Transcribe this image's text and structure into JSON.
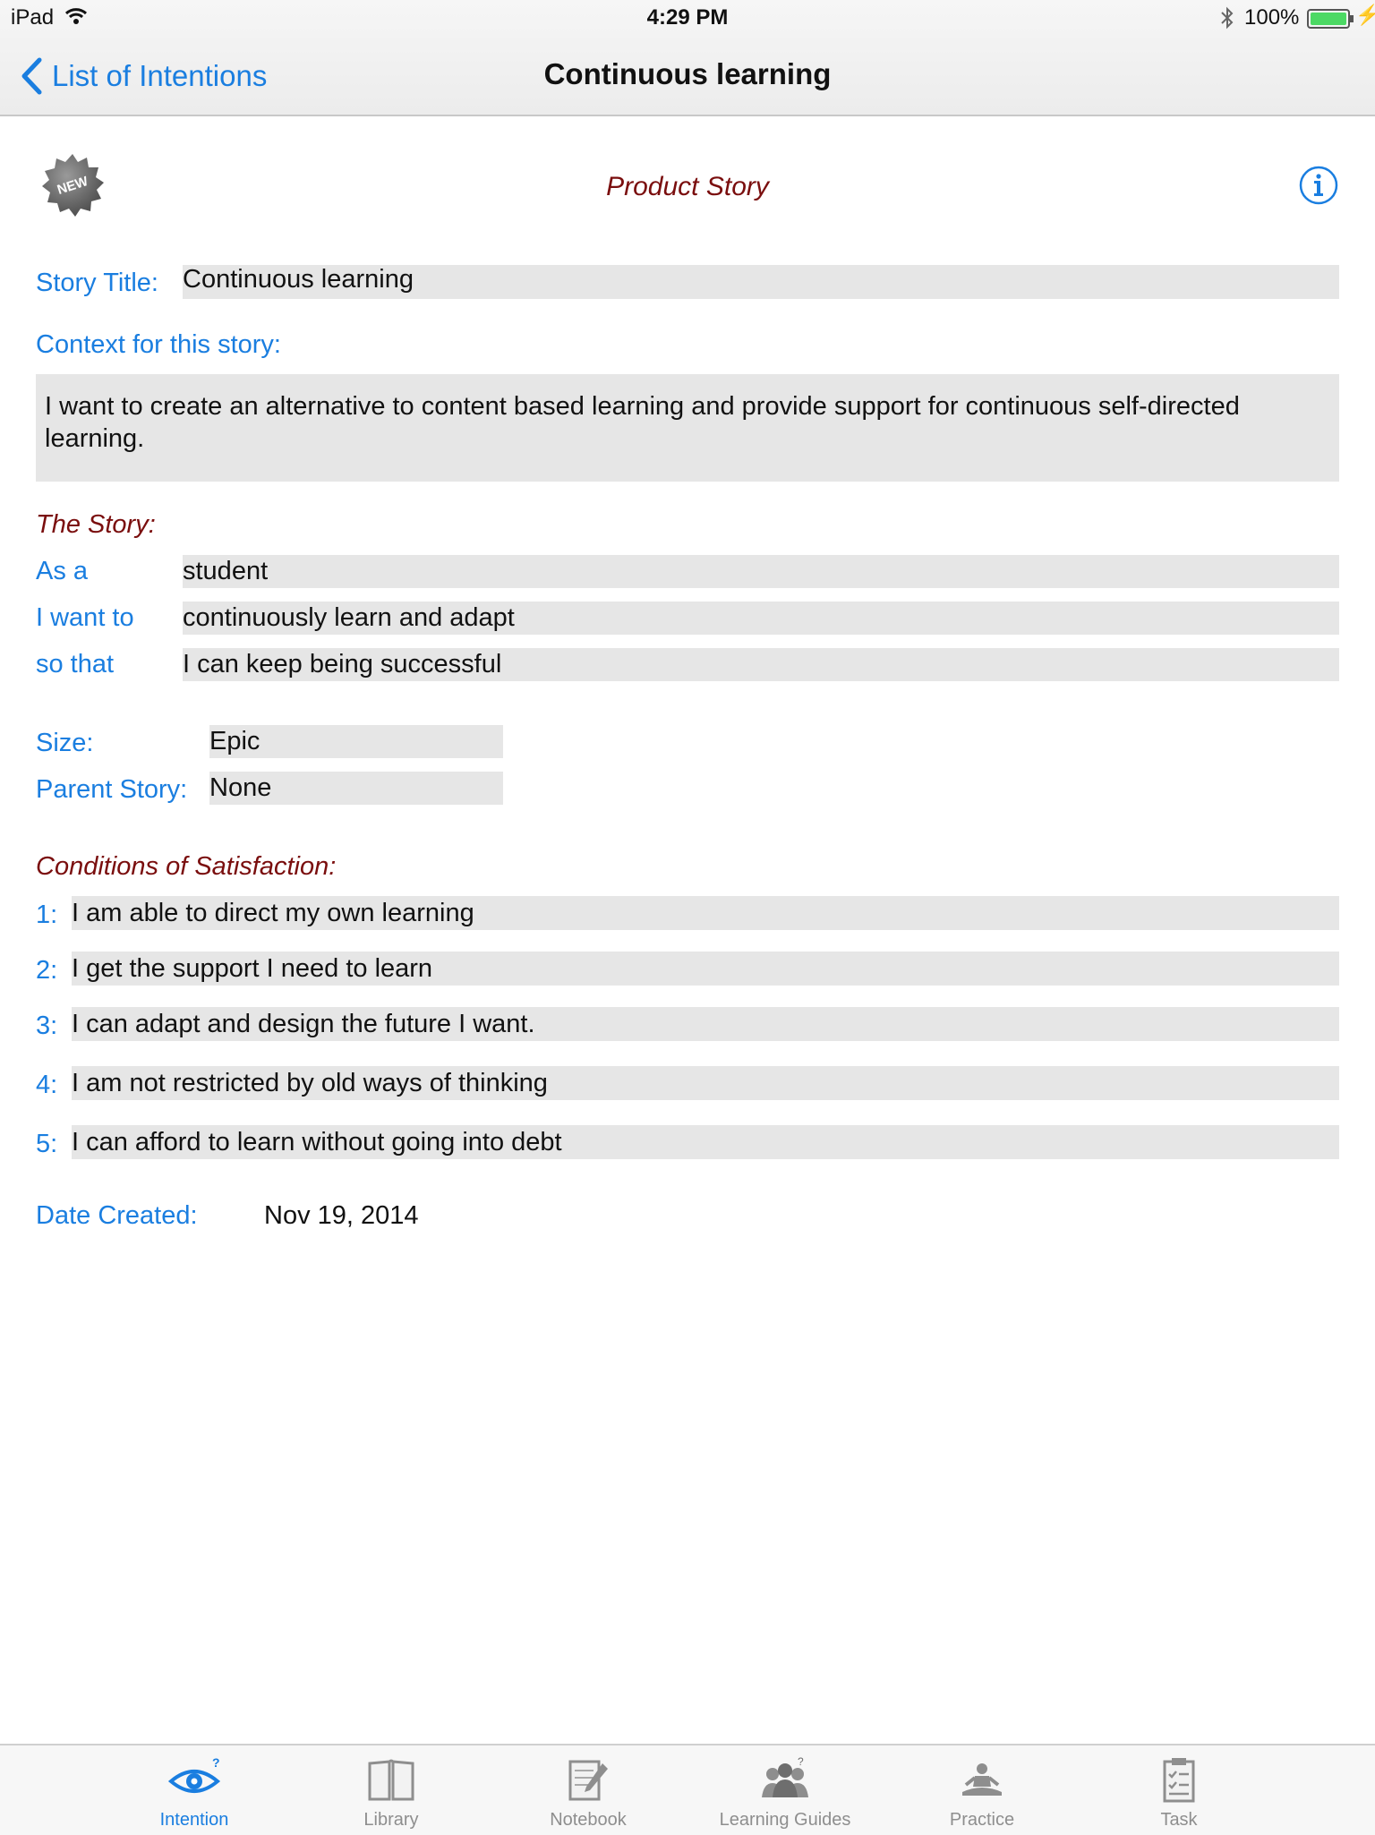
{
  "status_bar": {
    "device": "iPad",
    "time": "4:29 PM",
    "battery": "100%"
  },
  "nav": {
    "back_label": "List of Intentions",
    "title": "Continuous learning"
  },
  "header": {
    "badge_text": "NEW",
    "section_title": "Product Story"
  },
  "story": {
    "title_label": "Story Title:",
    "title_value": "Continuous learning",
    "context_label": "Context for this story:",
    "context_value": "I want to create an alternative to content based learning and provide support for continuous self-directed learning.",
    "the_story_label": "The Story:",
    "as_a_label": "As a",
    "as_a_value": "student",
    "i_want_label": "I want to",
    "i_want_value": "continuously learn and adapt",
    "so_that_label": "so that",
    "so_that_value": "I can keep being successful",
    "size_label": "Size:",
    "size_value": "Epic",
    "parent_label": "Parent Story:",
    "parent_value": "None"
  },
  "conditions": {
    "label": "Conditions of Satisfaction:",
    "items": [
      {
        "num": "1:",
        "text": "I am able to direct my own learning"
      },
      {
        "num": "2:",
        "text": "I get the support I need to learn"
      },
      {
        "num": "3:",
        "text": "I can adapt and design the future I want."
      },
      {
        "num": "4:",
        "text": "I am not restricted by old ways of thinking"
      },
      {
        "num": "5:",
        "text": "I can afford to learn without going into debt"
      }
    ]
  },
  "date": {
    "label": "Date Created:",
    "value": "Nov 19, 2014"
  },
  "tabbar": {
    "items": [
      {
        "label": "Intention",
        "icon": "eye-icon",
        "active": true
      },
      {
        "label": "Library",
        "icon": "book-icon"
      },
      {
        "label": "Notebook",
        "icon": "notebook-icon"
      },
      {
        "label": "Learning Guides",
        "icon": "people-icon"
      },
      {
        "label": "Practice",
        "icon": "meditation-icon"
      },
      {
        "label": "Task",
        "icon": "checklist-icon"
      }
    ]
  },
  "colors": {
    "accent": "#1a7ee0",
    "maroon": "#7a0e0e",
    "field": "#e6e6e6"
  }
}
